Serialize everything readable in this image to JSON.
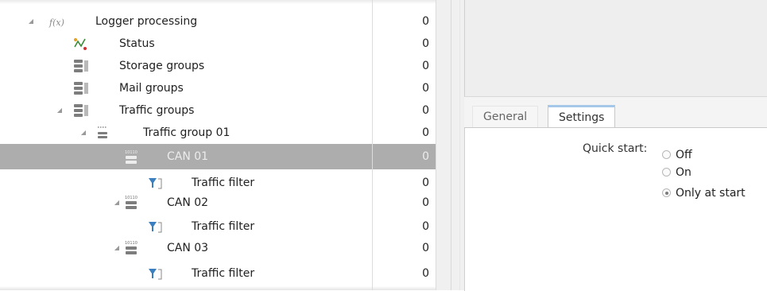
{
  "tree": {
    "rows": [
      {
        "label": "Logger processing",
        "value": "0",
        "icon": "f(x)-function-icon"
      },
      {
        "label": "Status",
        "value": "0",
        "icon": "status-chart-icon"
      },
      {
        "label": "Storage groups",
        "value": "0",
        "icon": "database-stack-icon"
      },
      {
        "label": "Mail groups",
        "value": "0",
        "icon": "database-stack-icon"
      },
      {
        "label": "Traffic groups",
        "value": "0",
        "icon": "database-stack-icon"
      },
      {
        "label": "Traffic group 01",
        "value": "0",
        "icon": "traffic-group-icon"
      },
      {
        "label": "CAN 01",
        "value": "0",
        "icon": "can-channel-icon",
        "selected": true
      },
      {
        "label": "Traffic filter",
        "value": "0",
        "icon": "filter-icon"
      },
      {
        "label": "CAN 02",
        "value": "0",
        "icon": "can-channel-icon"
      },
      {
        "label": "Traffic filter",
        "value": "0",
        "icon": "filter-icon"
      },
      {
        "label": "CAN 03",
        "value": "0",
        "icon": "can-channel-icon"
      },
      {
        "label": "Traffic filter",
        "value": "0",
        "icon": "filter-icon"
      }
    ]
  },
  "tabs": [
    {
      "label": "General",
      "active": false
    },
    {
      "label": "Settings",
      "active": true
    }
  ],
  "settings": {
    "quick_start_label": "Quick start:",
    "options": [
      {
        "label": "Off",
        "checked": false
      },
      {
        "label": "On",
        "checked": false
      },
      {
        "label": "Only at start",
        "checked": true
      }
    ]
  },
  "colors": {
    "selection": "#adadad",
    "filter_icon": "#3a7fc0",
    "active_tab_accent": "#a6c8e8"
  }
}
